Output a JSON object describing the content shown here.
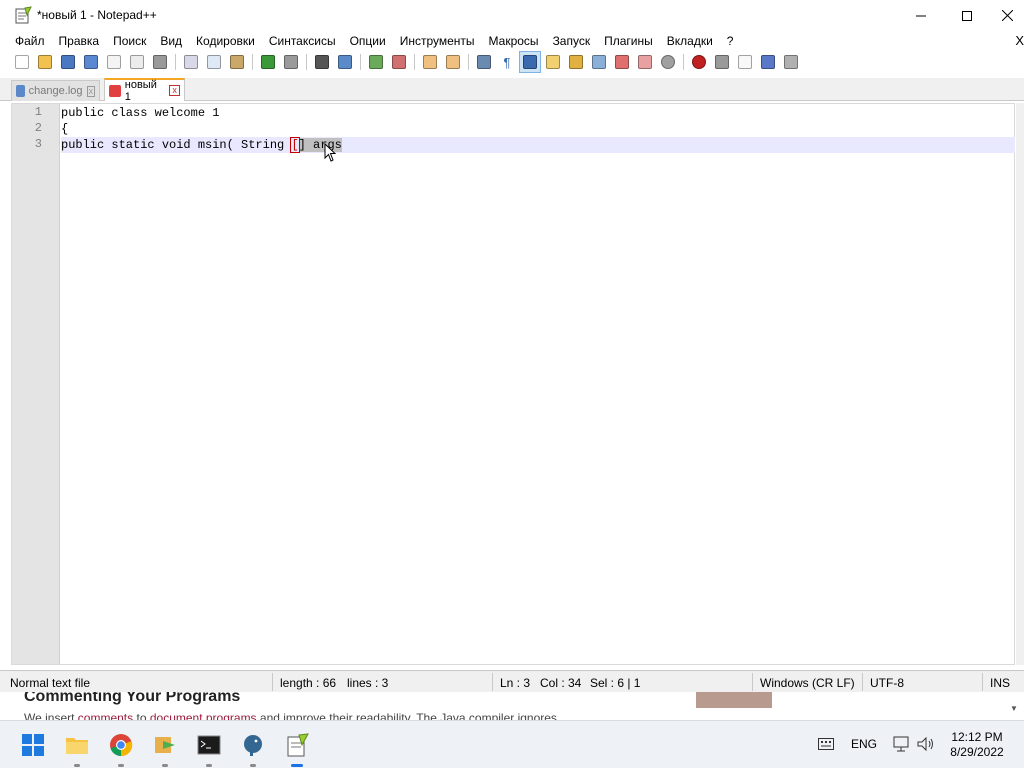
{
  "window": {
    "title": "*новый 1 - Notepad++"
  },
  "menu": [
    "Файл",
    "Правка",
    "Поиск",
    "Вид",
    "Кодировки",
    "Синтаксисы",
    "Опции",
    "Инструменты",
    "Макросы",
    "Запуск",
    "Плагины",
    "Вкладки",
    "?"
  ],
  "menu_close": "X",
  "tabs": [
    {
      "label": "change.log",
      "close": "x"
    },
    {
      "label": "новый 1",
      "close": "x"
    }
  ],
  "editor": {
    "line_numbers": [
      "1",
      "2",
      "3"
    ],
    "lines": {
      "l1": "public class welcome 1",
      "l2": "{",
      "l3_pre": "public static void msin( String ",
      "l3_mark": "[",
      "l3_hl": "] args"
    }
  },
  "status": {
    "type": "Normal text file",
    "length": "length : 66",
    "lines": "lines : 3",
    "ln": "Ln : 3",
    "col": "Col : 34",
    "sel": "Sel : 6 | 1",
    "eol": "Windows (CR LF)",
    "encoding": "UTF-8",
    "mode": "INS"
  },
  "background_page": {
    "title": "Commenting Your Programs",
    "sub_pre": "We insert ",
    "link1": "comments",
    "sub_mid": " to ",
    "link2": "document programs",
    "sub_post": " and improve their readability. The Java compiler ignores"
  },
  "tray": {
    "language": "ENG",
    "time": "12:12 PM",
    "date": "8/29/2022"
  },
  "colors": {
    "tab_accent": "#f5a623",
    "current_line": "#e8e8ff",
    "taskbar_active": "#1a73e8"
  }
}
